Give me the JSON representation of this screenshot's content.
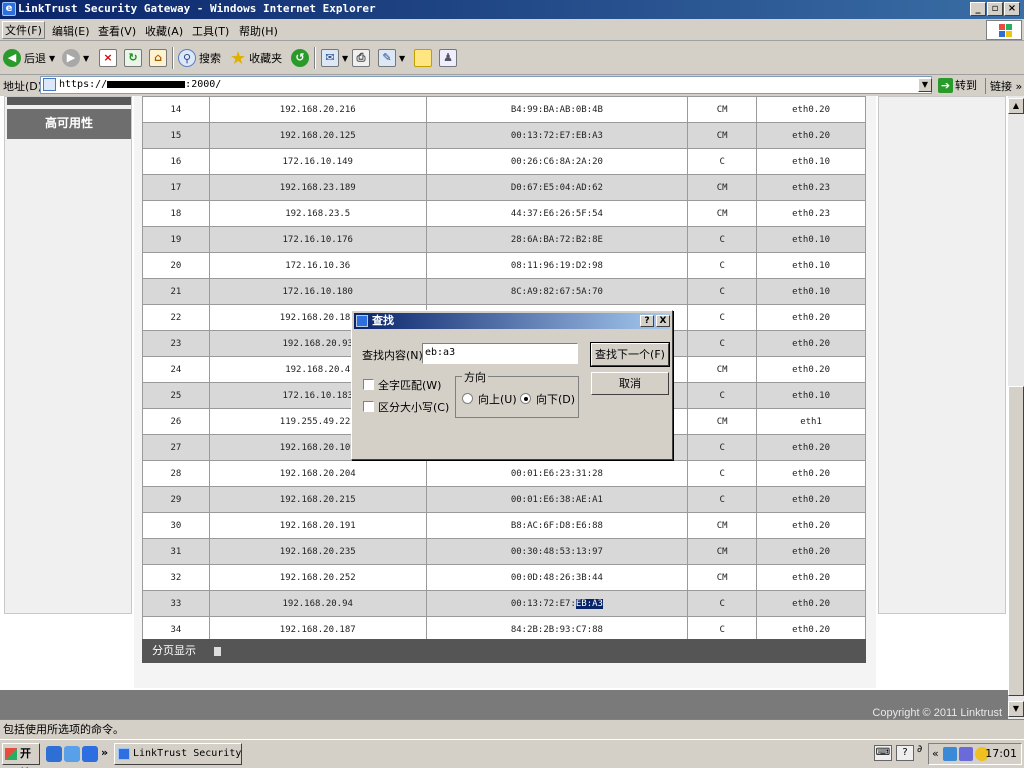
{
  "window": {
    "title": "LinkTrust Security Gateway - Windows Internet Explorer"
  },
  "menu": [
    "文件(F)",
    "编辑(E)",
    "查看(V)",
    "收藏(A)",
    "工具(T)",
    "帮助(H)"
  ],
  "toolbar": {
    "back": "后退",
    "search": "搜索",
    "favorites": "收藏夹"
  },
  "address": {
    "label": "地址(D)",
    "prefix": "https://",
    "suffix": ":2000/",
    "go": "转到",
    "links": "链接"
  },
  "sidebar": {
    "menu_item": "高可用性"
  },
  "arp_table": {
    "rows": [
      [
        "14",
        "192.168.20.216",
        "B4:99:BA:AB:0B:4B",
        "CM",
        "eth0.20"
      ],
      [
        "15",
        "192.168.20.125",
        "00:13:72:E7:EB:A3",
        "CM",
        "eth0.20"
      ],
      [
        "16",
        "172.16.10.149",
        "00:26:C6:8A:2A:20",
        "C",
        "eth0.10"
      ],
      [
        "17",
        "192.168.23.189",
        "D0:67:E5:04:AD:62",
        "CM",
        "eth0.23"
      ],
      [
        "18",
        "192.168.23.5",
        "44:37:E6:26:5F:54",
        "CM",
        "eth0.23"
      ],
      [
        "19",
        "172.16.10.176",
        "28:6A:BA:72:B2:8E",
        "C",
        "eth0.10"
      ],
      [
        "20",
        "172.16.10.36",
        "08:11:96:19:D2:98",
        "C",
        "eth0.10"
      ],
      [
        "21",
        "172.16.10.180",
        "8C:A9:82:67:5A:70",
        "C",
        "eth0.10"
      ],
      [
        "22",
        "192.168.20.182",
        "",
        "C",
        "eth0.20"
      ],
      [
        "23",
        "192.168.20.93",
        "",
        "C",
        "eth0.20"
      ],
      [
        "24",
        "192.168.20.4",
        "",
        "CM",
        "eth0.20"
      ],
      [
        "25",
        "172.16.10.183",
        "",
        "C",
        "eth0.10"
      ],
      [
        "26",
        "119.255.49.225",
        "",
        "CM",
        "eth1"
      ],
      [
        "27",
        "192.168.20.109",
        "",
        "C",
        "eth0.20"
      ],
      [
        "28",
        "192.168.20.204",
        "00:01:E6:23:31:28",
        "C",
        "eth0.20"
      ],
      [
        "29",
        "192.168.20.215",
        "00:01:E6:38:AE:A1",
        "C",
        "eth0.20"
      ],
      [
        "30",
        "192.168.20.191",
        "B8:AC:6F:D8:E6:88",
        "CM",
        "eth0.20"
      ],
      [
        "31",
        "192.168.20.235",
        "00:30:48:53:13:97",
        "CM",
        "eth0.20"
      ],
      [
        "32",
        "192.168.20.252",
        "00:0D:48:26:3B:44",
        "CM",
        "eth0.20"
      ],
      [
        "33",
        "192.168.20.94",
        "00:13:72:E7:",
        "C",
        "eth0.20"
      ],
      [
        "34",
        "192.168.20.187",
        "84:2B:2B:93:C7:88",
        "C",
        "eth0.20"
      ]
    ],
    "highlight_text": "EB:A3"
  },
  "pager": {
    "label": "分页显示"
  },
  "footer": {
    "copyright": "Copyright © 2011 Linktrust"
  },
  "find_dialog": {
    "title": "查找",
    "help_btn": "?",
    "close_btn": "X",
    "find_label": "查找内容(N):",
    "find_value": "eb:a3",
    "find_next": "查找下一个(F)",
    "cancel": "取消",
    "whole_word": "全字匹配(W)",
    "match_case": "区分大小写(C)",
    "direction_label": "方向",
    "up": "向上(U)",
    "down": "向下(D)",
    "selected_direction": "down"
  },
  "statusbar": {
    "text": "包括使用所选项的命令。"
  },
  "taskbar": {
    "start": "开始",
    "task": "LinkTrust Security ...",
    "clock": "17:01"
  },
  "colors": {
    "titlebar": "#0a246a",
    "highlight": "#0a246a",
    "even_row": "#d8d8d8",
    "pager": "#555555"
  }
}
